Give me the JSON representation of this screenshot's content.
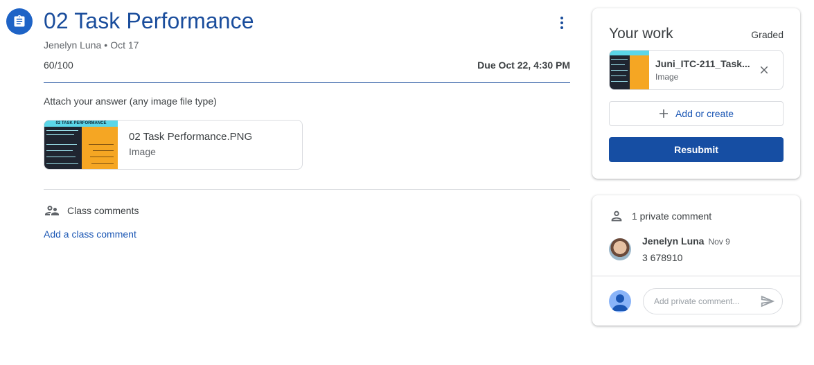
{
  "assignment": {
    "icon": "assignment-icon",
    "title": "02 Task Performance",
    "author": "Jenelyn Luna",
    "posted_date": "Oct 17",
    "meta_separator": "•",
    "points": "60/100",
    "due": "Due Oct 22, 4:30 PM",
    "instructions": "Attach your answer (any image file type)",
    "attachment": {
      "name": "02 Task Performance.PNG",
      "type": "Image",
      "thumb_banner": "02 TASK PERFORMANCE"
    },
    "class_comments_label": "Class comments",
    "add_class_comment": "Add a class comment"
  },
  "your_work": {
    "title": "Your work",
    "status": "Graded",
    "file": {
      "name": "Juni_ITC-211_Task...",
      "type": "Image"
    },
    "add_or_create": "Add or create",
    "resubmit": "Resubmit"
  },
  "private_comments": {
    "header": "1 private comment",
    "comments": [
      {
        "author": "Jenelyn Luna",
        "date": "Nov 9",
        "text": "3 678910"
      }
    ],
    "input_placeholder": "Add private comment..."
  },
  "colors": {
    "primary_blue": "#1a4d9c",
    "button_blue": "#164ea3",
    "link_blue": "#1a56b4",
    "icon_circle": "#1e63c6"
  }
}
